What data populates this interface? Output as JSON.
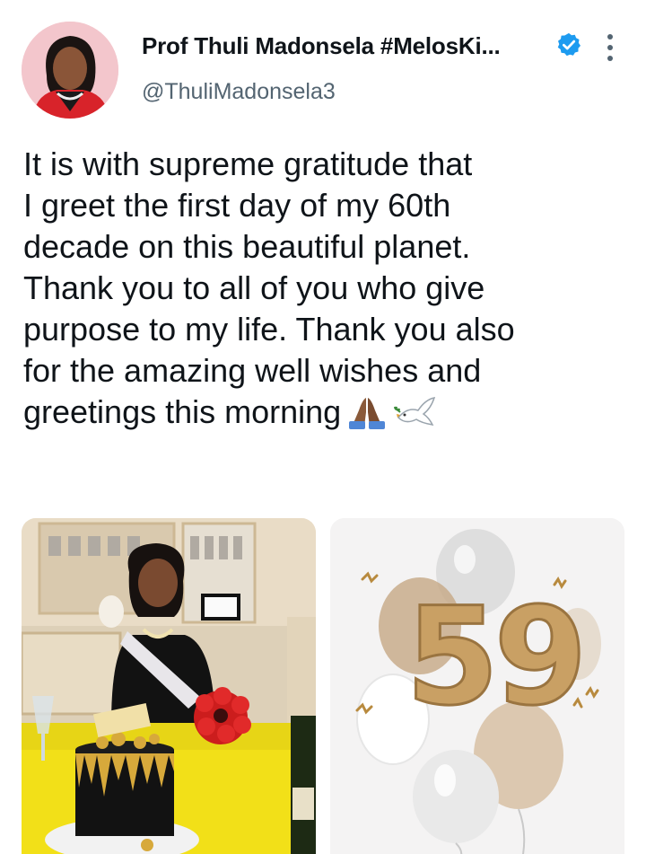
{
  "author": {
    "display_name": "Prof Thuli Madonsela #MelosKi...",
    "handle": "@ThuliMadonsela3"
  },
  "icons": {
    "verified": "verified-badge-icon",
    "more": "more-options-icon",
    "emoji_1": "folded-hands-emoji",
    "emoji_2": "dove-emoji"
  },
  "tweet": {
    "lines": [
      "It is with supreme gratitude that",
      "I greet the first day of my 60th",
      "decade on this beautiful planet.",
      "Thank you to all of you who give",
      "purpose to my life. Thank you also",
      "for the amazing well wishes and",
      "greetings this morning"
    ]
  },
  "media": {
    "balloon_number": "59"
  },
  "colors": {
    "verified_blue": "#1d9bf0",
    "secondary_text": "#536471",
    "primary_text": "#0f1419",
    "gold": "#c9a064"
  }
}
